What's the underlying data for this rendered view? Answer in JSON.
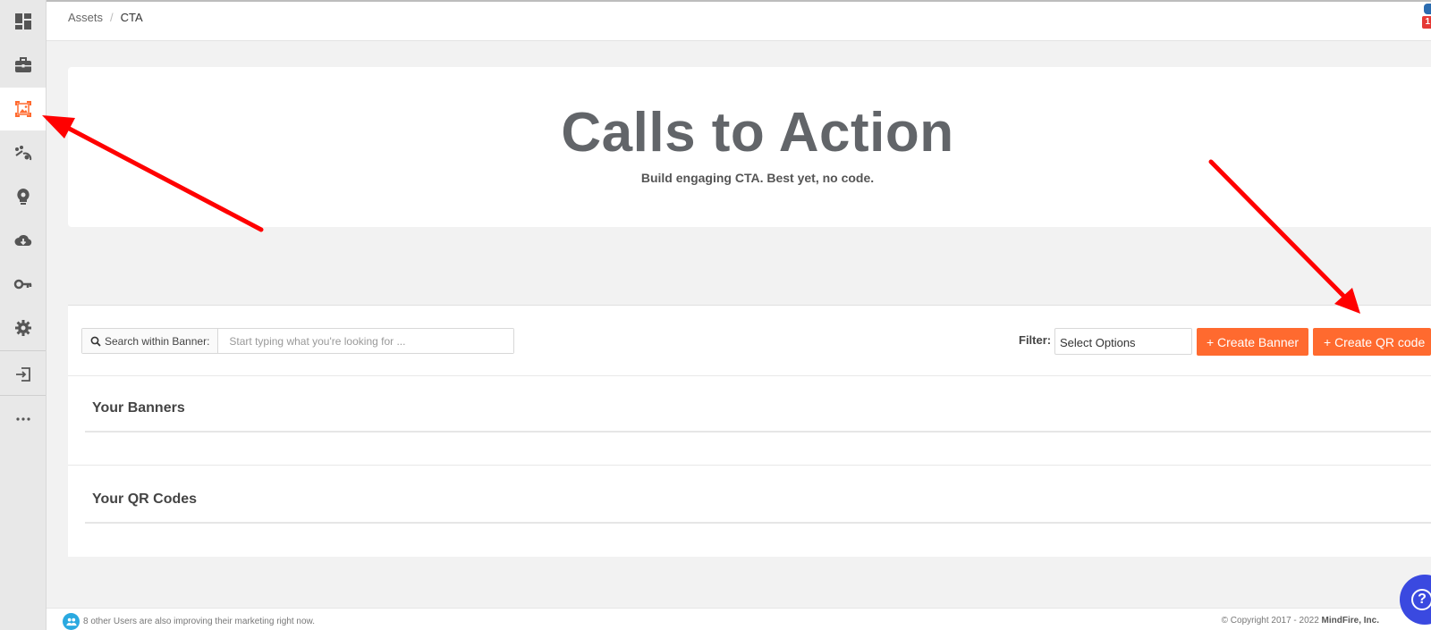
{
  "breadcrumb": {
    "parent": "Assets",
    "separator": "/",
    "current": "CTA"
  },
  "notification": {
    "count": "1"
  },
  "sidebar": {
    "items": [
      {
        "icon": "dashboard-icon"
      },
      {
        "icon": "briefcase-icon"
      },
      {
        "icon": "image-asset-icon",
        "active": true
      },
      {
        "icon": "journey-icon"
      },
      {
        "icon": "lightbulb-icon"
      },
      {
        "icon": "cloud-download-icon"
      },
      {
        "icon": "key-icon"
      },
      {
        "icon": "gear-icon"
      },
      {
        "icon": "logout-icon"
      },
      {
        "icon": "more-icon"
      }
    ],
    "active_color": "#ff6a2f"
  },
  "hero": {
    "title": "Calls to Action",
    "subtitle": "Build engaging CTA. Best yet, no code."
  },
  "toolbar": {
    "search_label": "Search within Banner:",
    "search_placeholder": "Start typing what you're looking for ...",
    "filter_label": "Filter:",
    "filter_value": "Select Options",
    "create_banner_label": "+ Create Banner",
    "create_qr_label": "+ Create QR code"
  },
  "sections": {
    "banners_title": "Your Banners",
    "qr_title": "Your QR Codes"
  },
  "footer": {
    "users_text": "8 other Users are also improving their marketing right now.",
    "copyright_prefix": "© Copyright 2017 - 2022",
    "company": "MindFire, Inc."
  },
  "help": {
    "label": "?"
  },
  "colors": {
    "accent": "#ff6a2f",
    "help": "#3a49e0",
    "annotation": "#ff0000"
  }
}
